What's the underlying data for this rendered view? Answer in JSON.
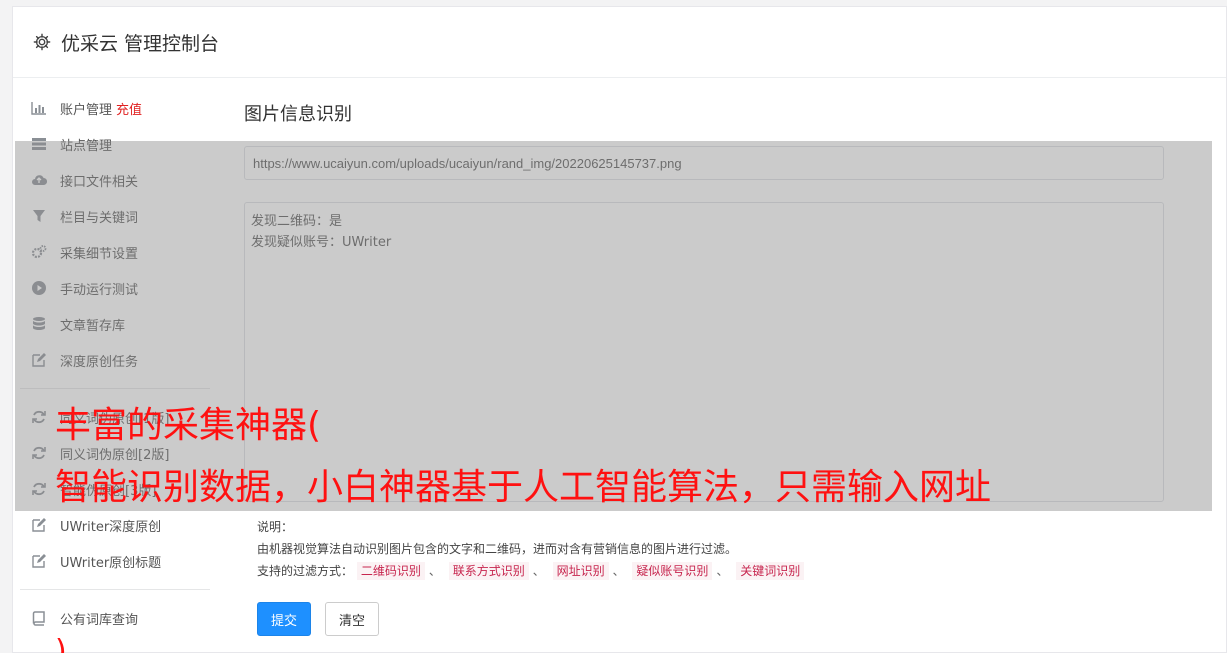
{
  "header": {
    "title": "优采云 管理控制台"
  },
  "sidebar": {
    "items": [
      {
        "label": "账户管理",
        "extra": "充值",
        "icon": "bar-chart-icon"
      },
      {
        "label": "站点管理",
        "icon": "server-icon"
      },
      {
        "label": "接口文件相关",
        "icon": "cloud-upload-icon"
      },
      {
        "label": "栏目与关键词",
        "icon": "filter-icon"
      },
      {
        "label": "采集细节设置",
        "icon": "cogs-icon"
      },
      {
        "label": "手动运行测试",
        "icon": "play-circle-icon"
      },
      {
        "label": "文章暂存库",
        "icon": "database-icon"
      },
      {
        "label": "深度原创任务",
        "icon": "edit-icon"
      },
      {
        "label": "同义词伪原创[1版]",
        "icon": "refresh-icon"
      },
      {
        "label": "同义词伪原创[2版]",
        "icon": "refresh-icon"
      },
      {
        "label": "智能伪原创[3版]",
        "icon": "refresh-icon"
      },
      {
        "label": "UWriter深度原创",
        "icon": "edit-icon"
      },
      {
        "label": "UWriter原创标题",
        "icon": "edit-icon"
      },
      {
        "label": "公有词库查询",
        "icon": "book-icon"
      }
    ]
  },
  "main": {
    "title": "图片信息识别",
    "url_value": "https://www.ucaiyun.com/uploads/ucaiyun/rand_img/20220625145737.png",
    "result_lines": [
      "发现二维码：是",
      "发现疑似账号：UWriter"
    ],
    "help_title": "说明：",
    "help_desc": "由机器视觉算法自动识别图片包含的文字和二维码，进而对含有营销信息的图片进行过滤。",
    "filter_label": "支持的过滤方式：",
    "filter_tags": [
      "二维码识别",
      "联系方式识别",
      "网址识别",
      "疑似账号识别",
      "关键词识别"
    ],
    "separator": "、",
    "submit_label": "提交",
    "clear_label": "清空"
  },
  "caption": {
    "line1": "丰富的采集神器(",
    "line2": "智能识别数据，小白神器基于人工智能算法，只需输入网址",
    "line3": ")"
  }
}
